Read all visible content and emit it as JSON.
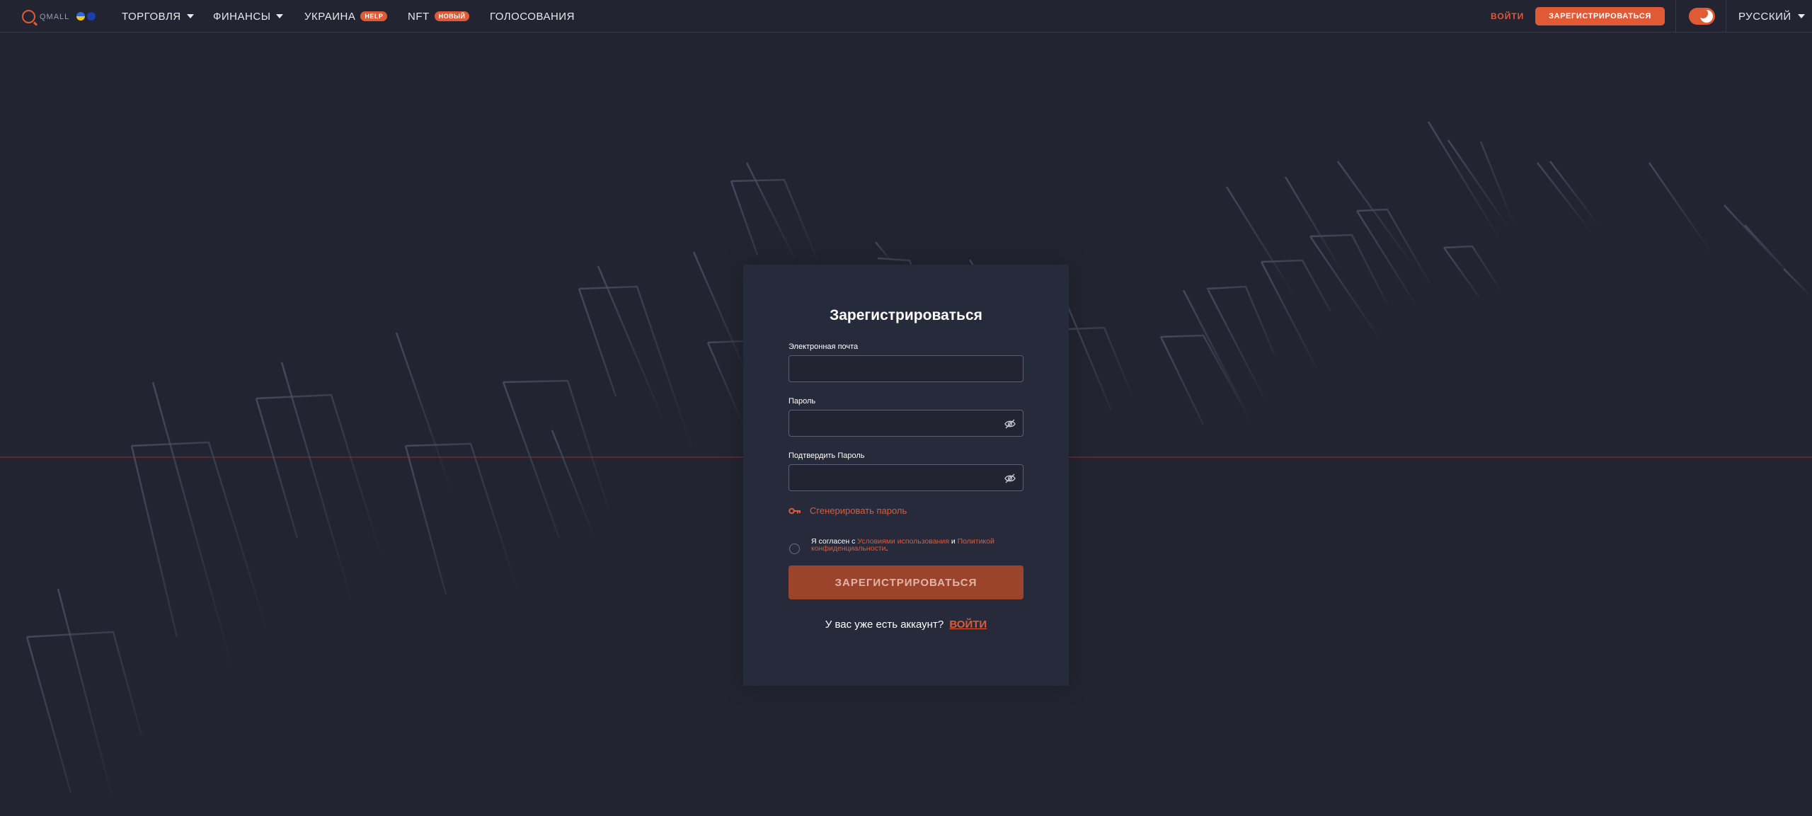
{
  "header": {
    "logo_text": "QMALL",
    "nav": {
      "trade": "ТОРГОВЛЯ",
      "finance": "ФИНАНСЫ",
      "ukraine": "УКРАИНА",
      "ukraine_badge": "HELP",
      "nft": "NFT",
      "nft_badge": "НОВЫЙ",
      "voting": "ГОЛОСОВАНИЯ"
    },
    "login": "ВОЙТИ",
    "register": "ЗАРЕГИСТРИРОВАТЬСЯ",
    "language": "РУССКИЙ"
  },
  "form": {
    "title": "Зарегистрироваться",
    "email_label": "Электронная почта",
    "email_value": "",
    "password_label": "Пароль",
    "password_value": "",
    "confirm_label": "Подтвердить Пароль",
    "confirm_value": "",
    "generate_password": "Сгенерировать пароль",
    "agree_prefix": "Я согласен с",
    "terms_link": "Условиями использования",
    "agree_and": "и",
    "privacy_link": "Политикой конфиденциальности",
    "agree_suffix": ".",
    "submit": "ЗАРЕГИСТРИРОВАТЬСЯ",
    "have_account": "У вас уже есть аккаунт?",
    "login_link": "ВОЙТИ"
  },
  "colors": {
    "accent": "#e05a36",
    "background": "#222431",
    "card": "#272a3a",
    "submit_disabled": "#9c432c"
  }
}
